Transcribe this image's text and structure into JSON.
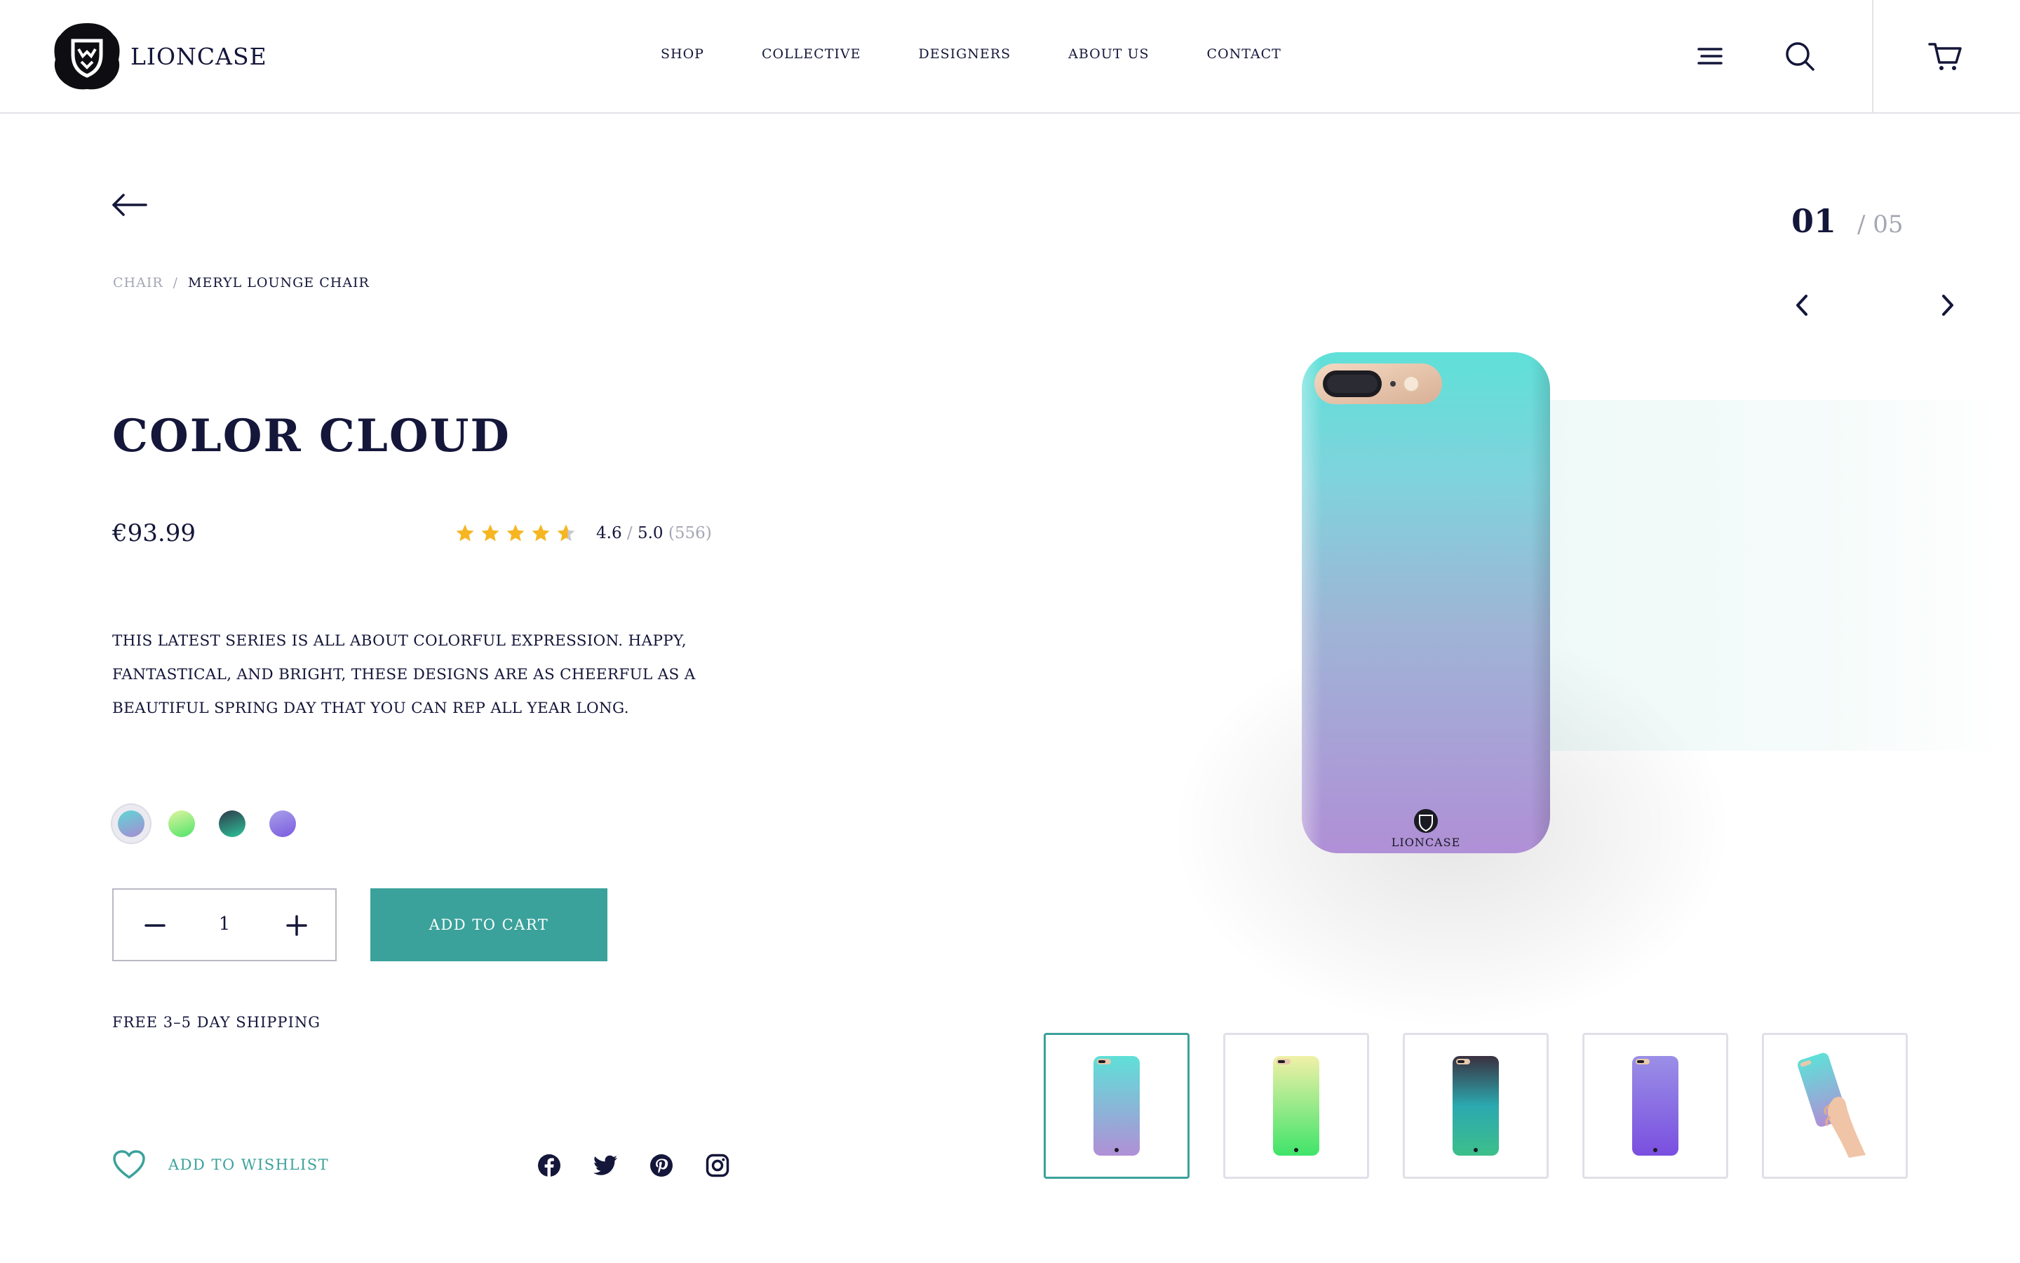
{
  "brand": {
    "name": "LIONCASE"
  },
  "nav": {
    "items": [
      {
        "label": "SHOP"
      },
      {
        "label": "COLLECTIVE"
      },
      {
        "label": "DESIGNERS"
      },
      {
        "label": "ABOUT US"
      },
      {
        "label": "CONTACT"
      }
    ]
  },
  "header_icons": [
    "menu-icon",
    "search-icon",
    "cart-icon"
  ],
  "breadcrumb": {
    "parent": "CHAIR",
    "separator": "/",
    "current": "MERYL LOUNGE CHAIR"
  },
  "product": {
    "title": "COLOR CLOUD",
    "price": "€93.99",
    "rating": {
      "value": "4.6",
      "separator": "/",
      "max": "5.0",
      "count": "(556)",
      "stars": 4.6
    },
    "description": "THIS LATEST SERIES  IS ALL ABOUT COLORFUL EXPRESSION. HAPPY, FANTASTICAL, AND BRIGHT, THESE DESIGNS ARE AS CHEERFUL AS A BEAUTIFUL SPRING DAY THAT YOU CAN REP ALL YEAR LONG.",
    "case_logo_text": "LIONCASE",
    "swatches": [
      {
        "name": "cloud",
        "from": "#5fd6d4",
        "to": "#a78bd3",
        "selected": true
      },
      {
        "name": "lime",
        "from": "#dff5a0",
        "to": "#4fe36a",
        "selected": false
      },
      {
        "name": "ocean",
        "from": "#2f3a4a",
        "to": "#2ec39a",
        "selected": false
      },
      {
        "name": "violet",
        "from": "#a8a0e8",
        "to": "#7a5be0",
        "selected": false
      }
    ],
    "quantity": "1",
    "add_to_cart_label": "ADD TO CART",
    "shipping_note": "FREE 3–5 DAY SHIPPING",
    "wishlist_label": "ADD TO WISHLIST"
  },
  "socials": [
    "facebook-icon",
    "twitter-icon",
    "pinterest-icon",
    "instagram-icon"
  ],
  "gallery": {
    "current": "01",
    "total": "/ 05",
    "active_index": 0
  },
  "colors": {
    "accent": "#3aa29b",
    "text": "#14163a",
    "muted": "#a4a6b3",
    "star": "#f5b622"
  }
}
